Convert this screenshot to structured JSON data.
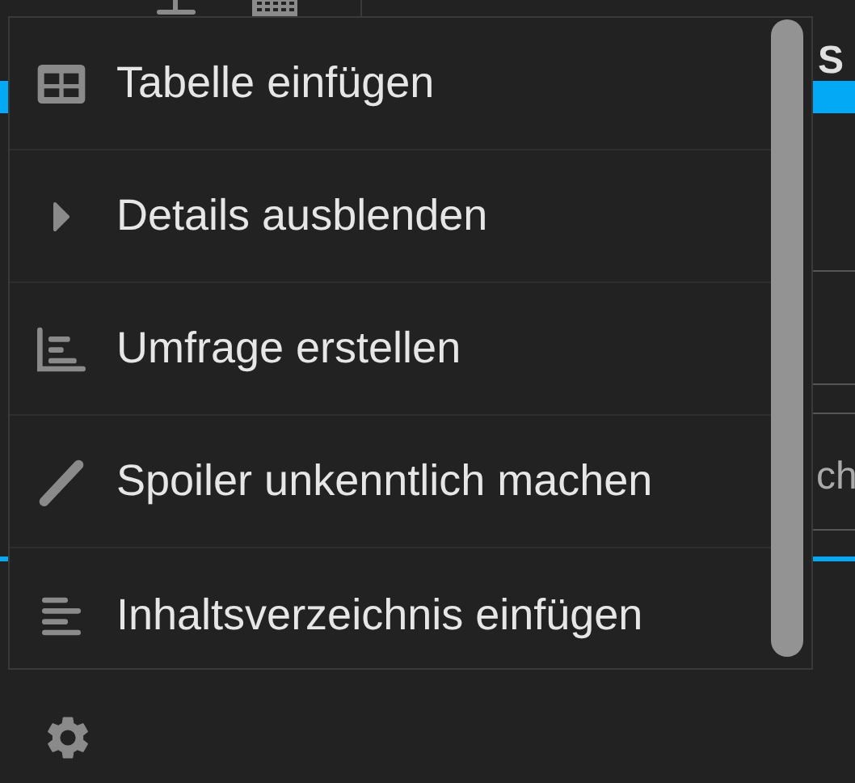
{
  "background": {
    "fragments": [
      "S",
      "ch"
    ]
  },
  "menu": {
    "items": [
      {
        "kind": "table",
        "label": "Tabelle einfügen"
      },
      {
        "kind": "details",
        "label": "Details ausblenden"
      },
      {
        "kind": "poll",
        "label": "Umfrage erstellen"
      },
      {
        "kind": "spoiler",
        "label": "Spoiler unkenntlich machen"
      },
      {
        "kind": "toc",
        "label": "Inhaltsverzeichnis einfügen"
      }
    ]
  }
}
